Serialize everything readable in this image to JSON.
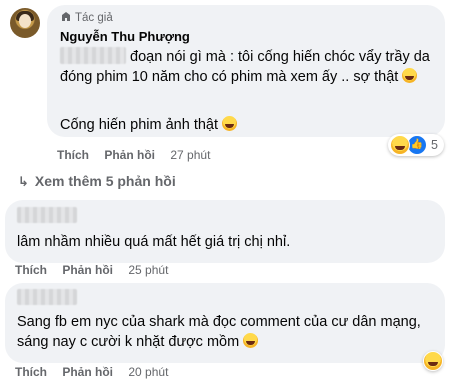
{
  "comments": [
    {
      "author_badge": "Tác giả",
      "author_name": "Nguyễn Thu Phượng",
      "text_line1": "đoạn nói gì mà : tôi cống hiến chóc vẩy trầy da đóng phim 10 năm cho có phim mà xem ấy .. sợ thật",
      "text_line2": "Cống hiến phim ảnh thật",
      "like_label": "Thích",
      "reply_label": "Phản hồi",
      "time": "27 phút",
      "reaction_count": "5"
    },
    {
      "text": "lâm nhầm nhiều quá mất hết giá trị chị nhỉ.",
      "like_label": "Thích",
      "reply_label": "Phản hồi",
      "time": "25 phút"
    },
    {
      "text": "Sang fb em nyc của shark mà đọc comment của cư dân mạng, sáng nay c cười k nhặt được mồm",
      "like_label": "Thích",
      "reply_label": "Phản hồi",
      "time": "20 phút"
    }
  ],
  "more_replies": "Xem thêm 5 phản hồi",
  "icons": {
    "badge": "author-badge-icon",
    "reply_arrow": "reply-arrow-icon",
    "reaction_haha": "haha-reaction-icon",
    "reaction_like": "like-reaction-icon"
  }
}
